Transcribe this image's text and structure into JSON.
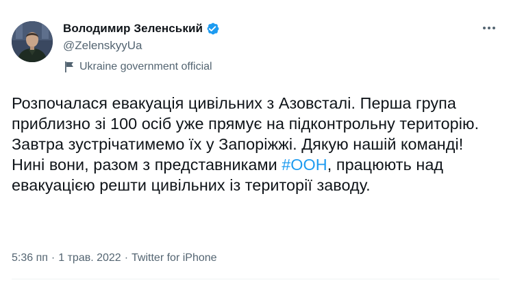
{
  "author": {
    "display_name": "Володимир Зеленський",
    "handle": "@ZelenskyyUa",
    "label": "Ukraine government official",
    "avatar_icon": "profile-photo",
    "verified_icon": "verified-badge-icon",
    "label_icon": "government-flag-icon"
  },
  "tweet": {
    "text_part1": "Розпочалася евакуація цивільних з Азовсталі. Перша група приблизно зі 100 осіб уже прямує на підконтрольну територію. Завтра зустрічатимемо їх у Запоріжжі. Дякую нашій команді! Нині вони, разом з представниками ",
    "hashtag": "#ООН",
    "text_part2": ", працюють над евакуацією решти цивільних із території заводу."
  },
  "meta": {
    "time": "5:36 пп",
    "separator": "·",
    "date": "1 трав. 2022",
    "source": "Twitter for iPhone"
  },
  "colors": {
    "accent": "#1d9bf0",
    "text": "#0f1419",
    "muted": "#536471"
  },
  "menu": {
    "more_icon": "more-dots-icon"
  }
}
